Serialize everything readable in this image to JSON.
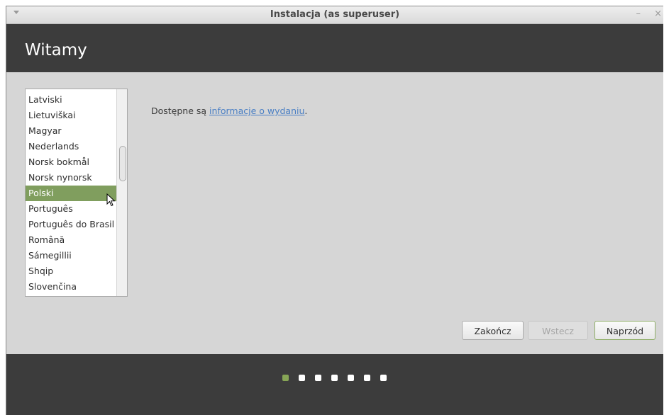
{
  "window": {
    "title": "Instalacja (as superuser)",
    "minimize_glyph": "–",
    "close_glyph": "×"
  },
  "header": {
    "heading": "Witamy"
  },
  "language_list": {
    "items": [
      "Latviski",
      "Lietuviškai",
      "Magyar",
      "Nederlands",
      "Norsk bokmål",
      "Norsk nynorsk",
      "Polski",
      "Português",
      "Português do Brasil",
      "Română",
      "Sámegillii",
      "Shqip",
      "Slovenčina"
    ],
    "selected": "Polski"
  },
  "main": {
    "release_prefix": "Dostępne są ",
    "release_link": "informacje o wydaniu",
    "release_suffix": "."
  },
  "buttons": {
    "quit": "Zakończ",
    "back": "Wstecz",
    "forward": "Naprzód"
  },
  "progress": {
    "total_steps": 7,
    "current_step": 1
  },
  "colors": {
    "accent": "#87a556",
    "selection": "#809e5e",
    "header_bg": "#3c3c3c",
    "link": "#4a7fc4"
  },
  "icons": [
    "menu-arrow-icon",
    "minimize-icon",
    "close-icon",
    "mouse-cursor-icon"
  ]
}
